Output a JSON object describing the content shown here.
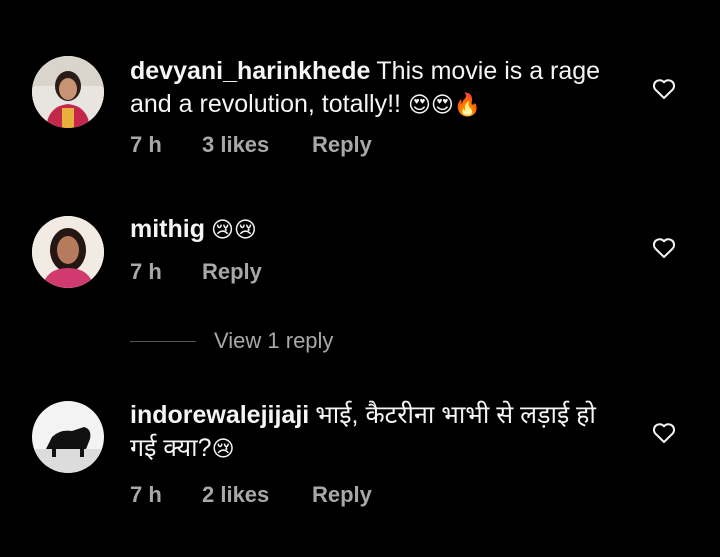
{
  "comments": [
    {
      "username": "devyani_harinkhede",
      "text": "This movie is a rage and a revolution, totally!!",
      "emojis": "😍😍🔥",
      "time": "7 h",
      "likes": "3 likes",
      "reply_label": "Reply"
    },
    {
      "username": "mithig",
      "text": "",
      "emojis": "😢😢",
      "time": "7 h",
      "reply_label": "Reply"
    },
    {
      "username": "indorewalejijaji",
      "text": "भाई, कैटरीना भाभी से लड़ाई हो गई क्या?",
      "emojis": "😢",
      "time": "7 h",
      "likes": "2 likes",
      "reply_label": "Reply"
    }
  ],
  "view_replies": {
    "label": "View 1 reply"
  },
  "icons": {
    "like": "heart-outline-icon"
  },
  "colors": {
    "background": "#000000",
    "primary_text": "#f5f5f5",
    "secondary_text": "#a8a8a8"
  }
}
